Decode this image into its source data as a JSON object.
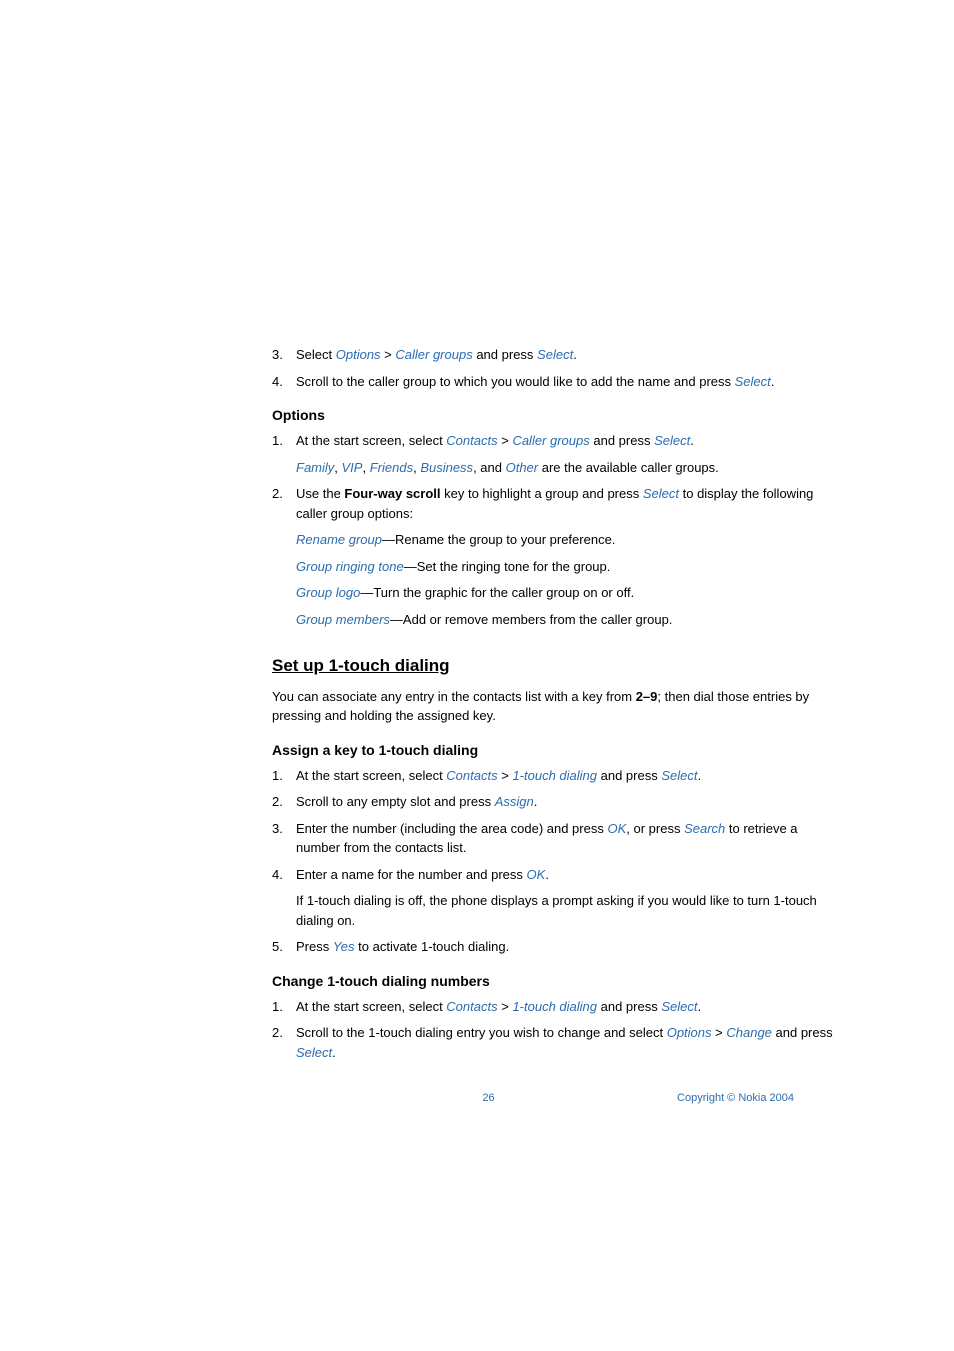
{
  "step3": {
    "num": "3.",
    "pre": "Select ",
    "link1": "Options",
    "sep": " > ",
    "link2": "Caller groups",
    "mid": " and press ",
    "link3": "Select",
    "post": "."
  },
  "step4": {
    "num": "4.",
    "pre": "Scroll to the caller group to which you would like to add the name and press ",
    "link1": "Select",
    "post": "."
  },
  "options_heading": "Options",
  "opt1": {
    "num": "1.",
    "pre": "At the start screen, select ",
    "link1": "Contacts",
    "sep": " > ",
    "link2": "Caller groups",
    "mid": " and press ",
    "link3": "Select",
    "post": "."
  },
  "opt1_sub": {
    "link1": "Family",
    "c1": ", ",
    "link2": "VIP",
    "c2": ", ",
    "link3": "Friends",
    "c3": ", ",
    "link4": "Business",
    "c4": ", and ",
    "link5": "Other",
    "post": " are the available caller groups."
  },
  "opt2": {
    "num": "2.",
    "pre": "Use the ",
    "bold": "Four-way scroll",
    "mid": " key to highlight a group and press ",
    "link1": "Select",
    "post": " to display the following caller group options:"
  },
  "opt2_sub1": {
    "link": "Rename group",
    "text": "—Rename the group to your preference."
  },
  "opt2_sub2": {
    "link": "Group ringing tone",
    "text": "—Set the ringing tone for the group."
  },
  "opt2_sub3": {
    "link": "Group logo",
    "text": "—Turn the graphic for the caller group on or off."
  },
  "opt2_sub4": {
    "link": "Group members",
    "text": "—Add or remove members from the caller group."
  },
  "setup_heading": "Set up 1-touch dialing",
  "setup_intro": {
    "pre": "You can associate any entry in the contacts list with a key from ",
    "bold": "2–9",
    "post": "; then dial those entries by pressing and holding the assigned key."
  },
  "assign_heading": "Assign a key to 1-touch dialing",
  "assign1": {
    "num": "1.",
    "pre": "At the start screen, select ",
    "link1": "Contacts",
    "sep": " > ",
    "link2": "1-touch dialing",
    "mid": " and press ",
    "link3": "Select",
    "post": "."
  },
  "assign2": {
    "num": "2.",
    "pre": "Scroll to any empty slot and press ",
    "link1": "Assign",
    "post": "."
  },
  "assign3": {
    "num": "3.",
    "pre": "Enter the number (including the area code) and press ",
    "link1": "OK",
    "mid": ", or press ",
    "link2": "Search",
    "post": " to retrieve a number from the contacts list."
  },
  "assign4": {
    "num": "4.",
    "pre": "Enter a name for the number and press ",
    "link1": "OK",
    "post": "."
  },
  "assign4_sub": "If 1-touch dialing is off, the phone displays a prompt asking if you would like to turn 1-touch dialing on.",
  "assign5": {
    "num": "5.",
    "pre": "Press ",
    "link1": "Yes",
    "post": " to activate 1-touch dialing."
  },
  "change_heading": "Change 1-touch dialing numbers",
  "change1": {
    "num": "1.",
    "pre": "At the start screen, select ",
    "link1": "Contacts",
    "sep": " > ",
    "link2": "1-touch dialing",
    "mid": " and press ",
    "link3": "Select",
    "post": "."
  },
  "change2": {
    "num": "2.",
    "pre": "Scroll to the 1-touch dialing entry you wish to change and select ",
    "link1": "Options",
    "sep": " > ",
    "link2": "Change",
    "mid": " and press ",
    "link3": "Select",
    "post": "."
  },
  "footer": {
    "page": "26",
    "copyright": "Copyright © Nokia 2004"
  }
}
